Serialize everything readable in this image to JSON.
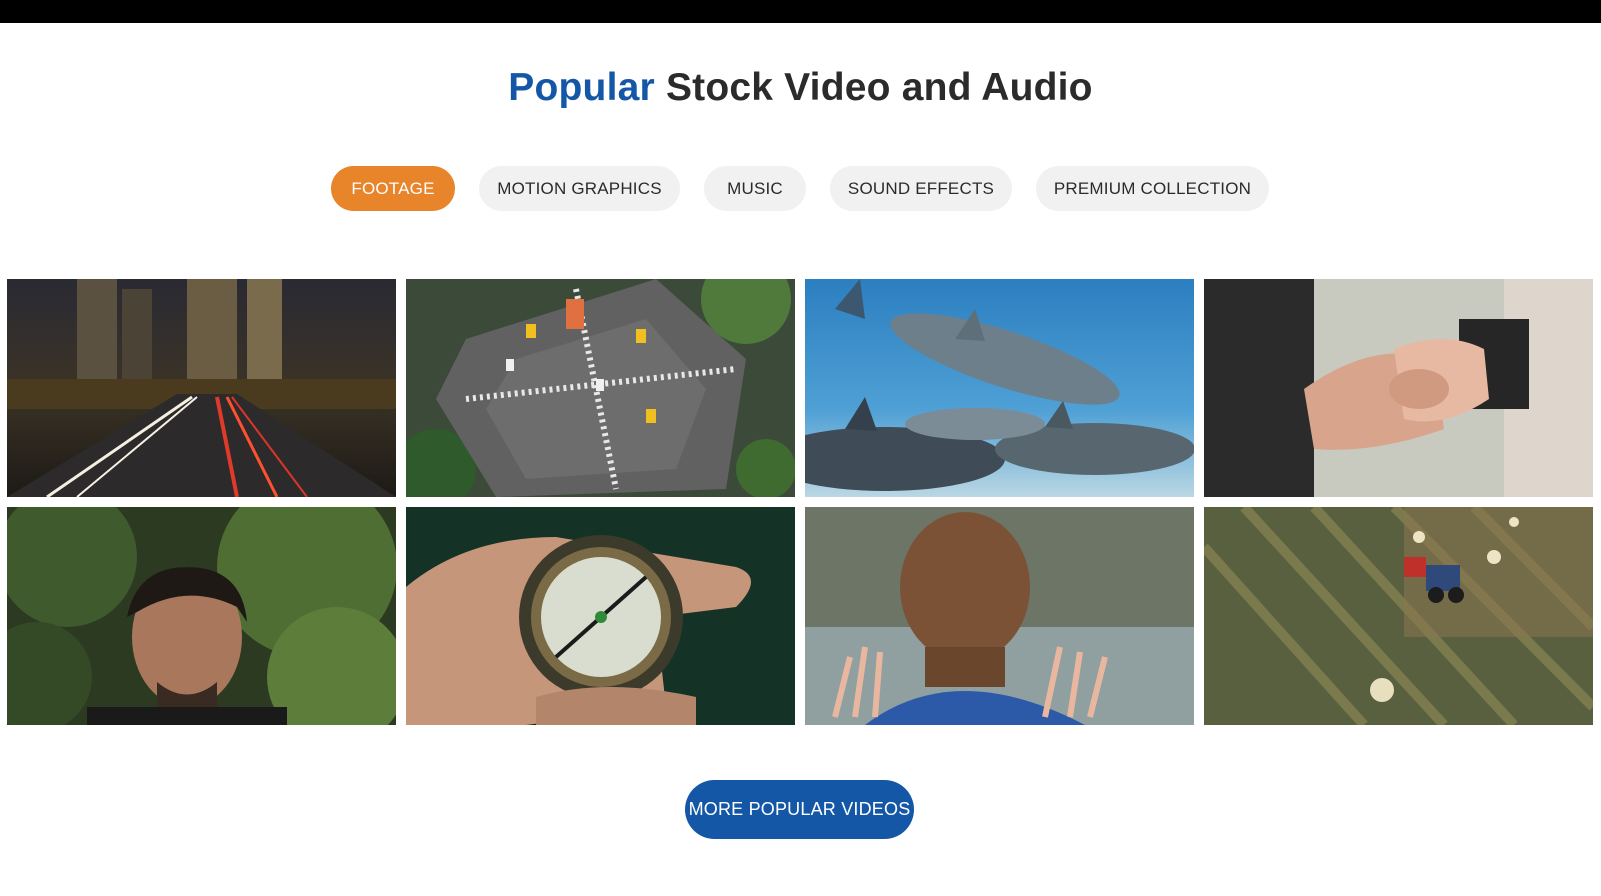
{
  "heading": {
    "accent": "Popular",
    "rest": "Stock Video and Audio"
  },
  "tabs": [
    {
      "label": "FOOTAGE",
      "active": true
    },
    {
      "label": "MOTION GRAPHICS",
      "active": false
    },
    {
      "label": "MUSIC",
      "active": false
    },
    {
      "label": "SOUND EFFECTS",
      "active": false
    },
    {
      "label": "PREMIUM COLLECTION",
      "active": false
    }
  ],
  "thumbnails": [
    {
      "subject": "city-highway-night"
    },
    {
      "subject": "aerial-intersection"
    },
    {
      "subject": "dolphins-underwater"
    },
    {
      "subject": "holding-hands"
    },
    {
      "subject": "man-in-forest"
    },
    {
      "subject": "hand-holding-compass"
    },
    {
      "subject": "boy-at-window"
    },
    {
      "subject": "tractor-in-field"
    }
  ],
  "more_button": {
    "label": "MORE POPULAR VIDEOS"
  },
  "colors": {
    "accent_blue": "#1457a6",
    "active_tab": "#e8842a",
    "tab_bg": "#f1f1f1",
    "text": "#2b2b2b"
  }
}
